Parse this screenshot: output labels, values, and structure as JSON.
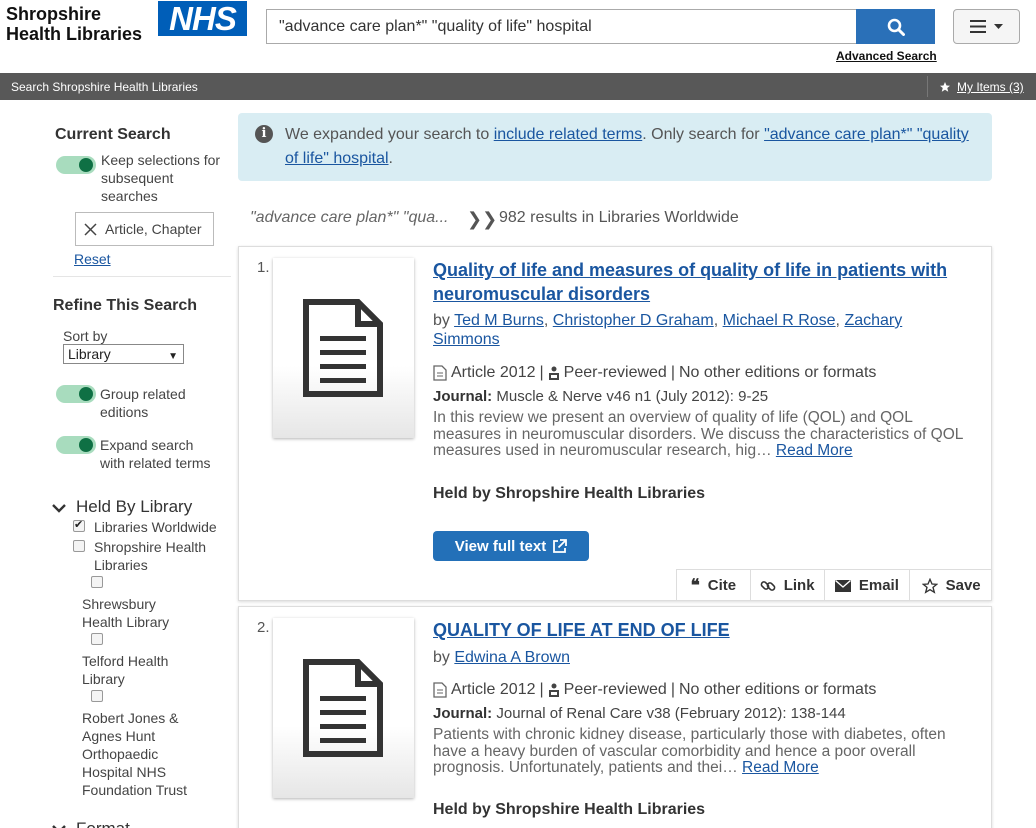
{
  "header": {
    "brand_line1": "Shropshire",
    "brand_line2": "Health Libraries",
    "nhs_logo": "NHS",
    "search_value": "\"advance care plan*\" \"quality of life\" hospital",
    "advanced_search": "Advanced Search"
  },
  "topbar": {
    "title": "Search Shropshire Health Libraries",
    "my_items": "My Items (3)"
  },
  "sidebar": {
    "current_search": "Current Search",
    "keep_selections_1": "Keep selections for",
    "keep_selections_2": "subsequent",
    "keep_selections_3": "searches",
    "filter_chip": "Article, Chapter",
    "reset": "Reset",
    "refine": "Refine This Search",
    "sort_by_label": "Sort by",
    "sort_by_value": "Library",
    "group_1": "Group related",
    "group_2": "editions",
    "expand_1": "Expand search",
    "expand_2": "with related terms",
    "held_by": "Held By Library",
    "libraries": {
      "worldwide": "Libraries Worldwide",
      "shropshire_1": "Shropshire Health",
      "shropshire_2": "Libraries",
      "shrewsbury_1": "Shrewsbury",
      "shrewsbury_2": "Health Library",
      "telford_1": "Telford Health",
      "telford_2": "Library",
      "rjah_1": "Robert Jones &",
      "rjah_2": "Agnes Hunt",
      "rjah_3": "Orthopaedic",
      "rjah_4": "Hospital NHS",
      "rjah_5": "Foundation Trust"
    },
    "format": "Format"
  },
  "info": {
    "prefix": "We expanded your search to ",
    "link1": "include related terms",
    "middle": ". Only search for ",
    "link2": "\"advance care plan*\" \"quality of life\" hospital",
    "suffix": "."
  },
  "summary": {
    "query": "\"advance care plan*\" \"qua...",
    "separator": "❯❯",
    "count": "982 results in Libraries Worldwide"
  },
  "results": [
    {
      "num": "1.",
      "title": "Quality of life and measures of quality of life in patients with neuromuscular disorders",
      "by": "by ",
      "authors": [
        "Ted M Burns",
        "Christopher D Graham",
        "Michael R Rose",
        "Zachary Simmons"
      ],
      "type": "Article 2012",
      "peer": "Peer-reviewed",
      "editions": "No other editions or formats",
      "journal_label": "Journal:",
      "journal": "Muscle & Nerve v46 n1 (July 2012): 9-25",
      "abstract": "In this review we present an overview of quality of life (QOL) and QOL measures in neuromuscular disorders. We discuss the characteristics of QOL measures used in neuromuscular research, hig…",
      "read_more": "Read More",
      "held": "Held by Shropshire Health Libraries",
      "view_full_text": "View full text",
      "actions": {
        "cite": "Cite",
        "link": "Link",
        "email": "Email",
        "save": "Save"
      }
    },
    {
      "num": "2.",
      "title": "QUALITY OF LIFE AT END OF LIFE",
      "by": "by ",
      "authors": [
        "Edwina A Brown"
      ],
      "type": "Article 2012",
      "peer": "Peer-reviewed",
      "editions": "No other editions or formats",
      "journal_label": "Journal:",
      "journal": "Journal of Renal Care v38 (February 2012): 138-144",
      "abstract": "Patients with chronic kidney disease, particularly those with diabetes, often have a heavy burden of vascular comorbidity and hence a poor overall prognosis. Unfortunately, patients and thei…",
      "read_more": "Read More",
      "held": "Held by Shropshire Health Libraries"
    }
  ],
  "colors": {
    "nhs_blue": "#005eb8",
    "link_blue": "#1a56a0",
    "button_blue": "#2370b8",
    "toggle_on": "#0f7044",
    "info_bg": "#d9edf3",
    "topbar_bg": "#585858"
  }
}
